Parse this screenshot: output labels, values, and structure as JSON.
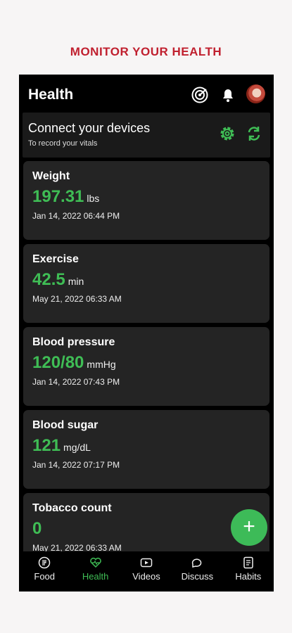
{
  "promo": "MONITOR YOUR HEALTH",
  "header": {
    "title": "Health"
  },
  "connect": {
    "title": "Connect your devices",
    "subtitle": "To record your vitals"
  },
  "cards": [
    {
      "label": "Weight",
      "value": "197.31",
      "unit": "lbs",
      "date": "Jan 14, 2022 06:44 PM"
    },
    {
      "label": "Exercise",
      "value": "42.5",
      "unit": "min",
      "date": "May 21, 2022 06:33 AM"
    },
    {
      "label": "Blood pressure",
      "value": "120/80",
      "unit": "mmHg",
      "date": "Jan 14, 2022 07:43 PM"
    },
    {
      "label": "Blood sugar",
      "value": "121",
      "unit": "mg/dL",
      "date": "Jan 14, 2022 07:17 PM"
    },
    {
      "label": "Tobacco count",
      "value": "0",
      "unit": "",
      "date": "May 21, 2022 06:33 AM"
    }
  ],
  "fab": "+",
  "nav": [
    {
      "label": "Food",
      "icon": "food-icon",
      "active": false
    },
    {
      "label": "Health",
      "icon": "heart-icon",
      "active": true
    },
    {
      "label": "Videos",
      "icon": "video-icon",
      "active": false
    },
    {
      "label": "Discuss",
      "icon": "chat-icon",
      "active": false
    },
    {
      "label": "Habits",
      "icon": "habits-icon",
      "active": false
    }
  ],
  "colors": {
    "accent": "#3fbd55",
    "promo": "#c0202f",
    "card": "#242424"
  }
}
